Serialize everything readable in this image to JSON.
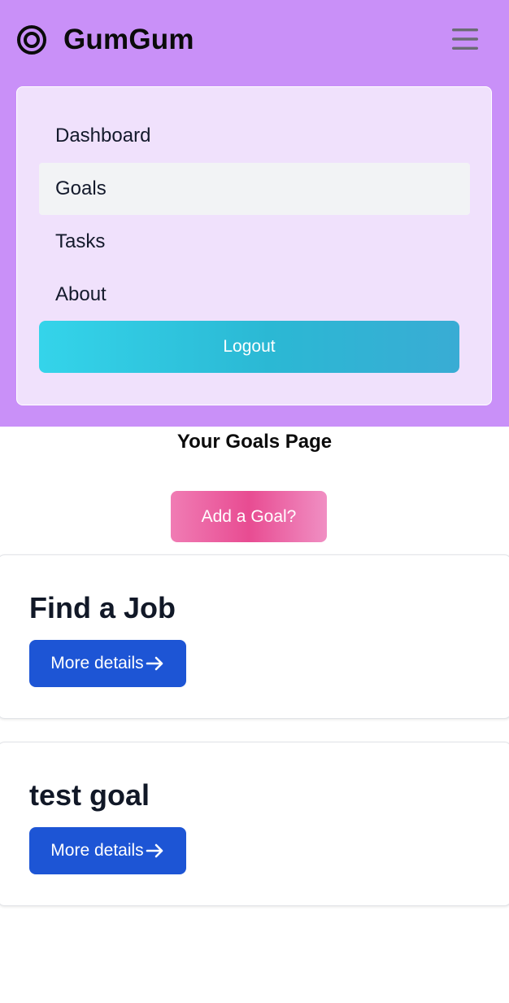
{
  "navbar": {
    "brand_name": "GumGum",
    "brand_icon": "target-icon",
    "menu_icon": "hamburger-menu-icon",
    "background_color": "#c990f8"
  },
  "menu": {
    "items": [
      {
        "label": "Dashboard",
        "active": false
      },
      {
        "label": "Goals",
        "active": true
      },
      {
        "label": "Tasks",
        "active": false
      },
      {
        "label": "About",
        "active": false
      }
    ],
    "logout_label": "Logout"
  },
  "main": {
    "page_title": "Your Goals Page",
    "add_goal_label": "Add a Goal?",
    "goals": [
      {
        "title": "Find a Job",
        "details_label": "More details",
        "details_icon": "arrow-right-icon"
      },
      {
        "title": "test goal",
        "details_label": "More details",
        "details_icon": "arrow-right-icon"
      }
    ]
  },
  "colors": {
    "logout_gradient": [
      "#34d4ea",
      "#39acd4"
    ],
    "add_goal_gradient": [
      "#f07cb4",
      "#e84c92"
    ],
    "details_button": "#1d55d5"
  }
}
